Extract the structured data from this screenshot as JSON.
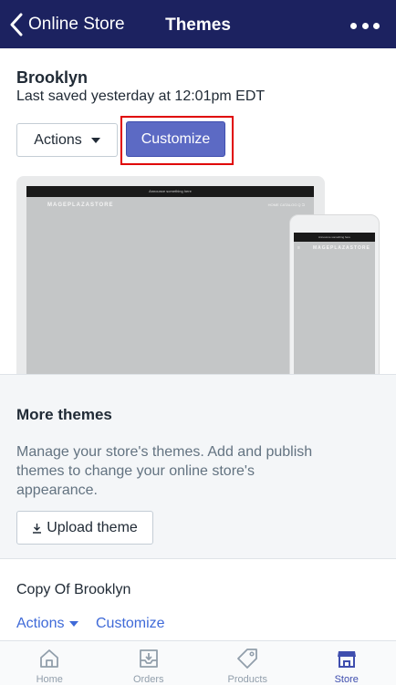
{
  "nav": {
    "back_label": "Online Store",
    "title": "Themes"
  },
  "current_theme": {
    "name": "Brooklyn",
    "saved": "Last saved yesterday at 12:01pm EDT",
    "actions_label": "Actions",
    "customize_label": "Customize",
    "preview": {
      "announcement": "Announce something here",
      "store_name": "MAGEPLAZASTORE",
      "nav_links": "HOME   CATALOG   Q   ⊐"
    }
  },
  "more_themes": {
    "title": "More themes",
    "description": "Manage your store's themes. Add and publish themes to change your online store's appearance.",
    "upload_label": "Upload theme"
  },
  "copy_theme": {
    "name": "Copy Of Brooklyn",
    "actions_label": "Actions",
    "customize_label": "Customize"
  },
  "tabs": [
    {
      "label": "Home",
      "icon": "home-icon"
    },
    {
      "label": "Orders",
      "icon": "orders-icon"
    },
    {
      "label": "Products",
      "icon": "tag-icon"
    },
    {
      "label": "Store",
      "icon": "store-icon",
      "active": true
    }
  ],
  "colors": {
    "nav_bg": "#1c2260",
    "primary": "#5c6ac4",
    "link": "#3f6ad8",
    "highlight": "#e00000",
    "active_tab": "#3f4eae"
  }
}
